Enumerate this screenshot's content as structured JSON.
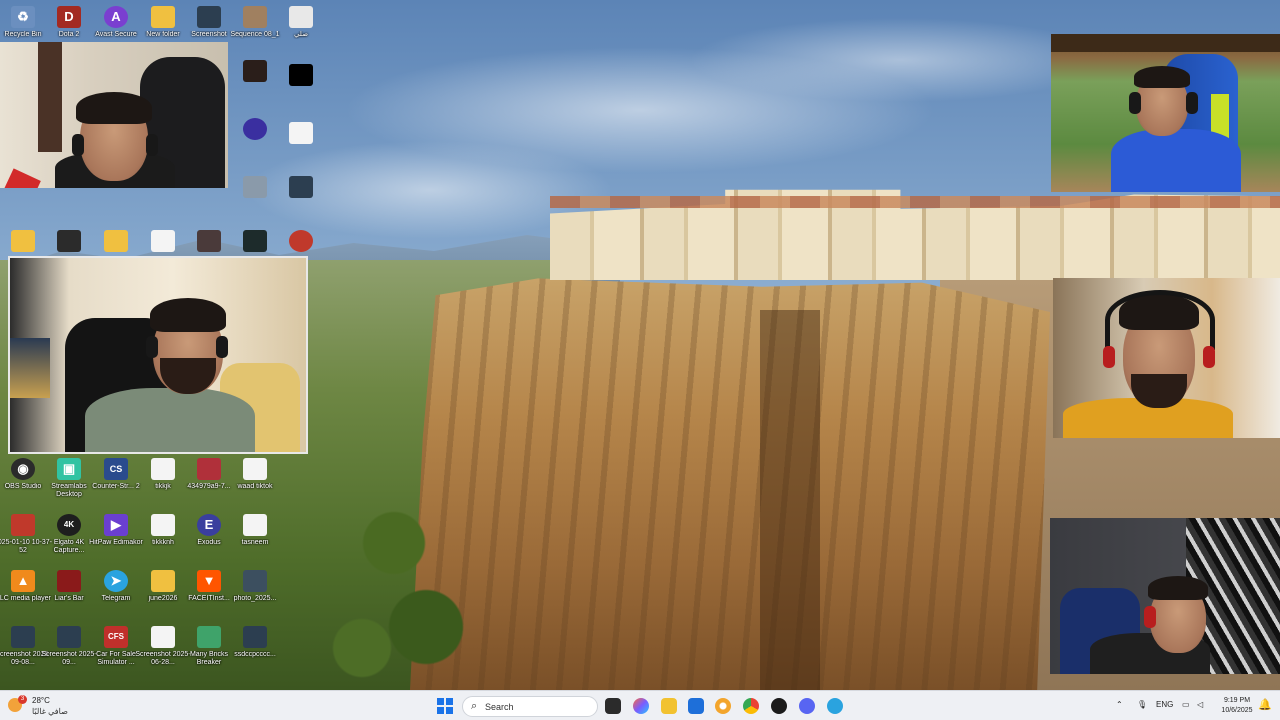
{
  "desktop_icons": [
    {
      "label": "Recycle Bin",
      "icon": "recycle-bin-icon",
      "glyph": "♻",
      "color": "#6b8fbf"
    },
    {
      "label": "Dota 2",
      "icon": "dota2-icon",
      "glyph": "D",
      "color": "#a32a22"
    },
    {
      "label": "Avast Secure",
      "icon": "avast-browser-icon",
      "glyph": "A",
      "color": "#7a3fd0"
    },
    {
      "label": "New folder",
      "icon": "folder-icon",
      "glyph": "",
      "color": "#f0c040"
    },
    {
      "label": "Screenshot",
      "icon": "image-file-icon",
      "glyph": "",
      "color": "#2c3e50"
    },
    {
      "label": "Sequence 08_1",
      "icon": "video-file-icon",
      "glyph": "",
      "color": "#a08060"
    },
    {
      "label": "صلي",
      "icon": "document-icon",
      "glyph": "",
      "color": "#e8e8e8"
    },
    {
      "label": "OBS Studio",
      "icon": "obs-studio-icon",
      "glyph": "◉",
      "color": "#2b2b2b"
    },
    {
      "label": "Streamlabs Desktop",
      "icon": "streamlabs-icon",
      "glyph": "▣",
      "color": "#31c3a2"
    },
    {
      "label": "Counter-Str... 2",
      "icon": "counter-strike-icon",
      "glyph": "CS",
      "color": "#2a4b8d"
    },
    {
      "label": "tikkjk",
      "icon": "text-file-icon",
      "glyph": "",
      "color": "#f4f4f4"
    },
    {
      "label": "434979a9-7...",
      "icon": "video-file-icon",
      "glyph": "",
      "color": "#b0303a"
    },
    {
      "label": "waad tiktok",
      "icon": "text-file-icon",
      "glyph": "",
      "color": "#f4f4f4"
    },
    {
      "label": "2025-01-10 10-37-52",
      "icon": "video-file-icon",
      "glyph": "",
      "color": "#c0392b"
    },
    {
      "label": "Elgato 4K Capture...",
      "icon": "elgato-icon",
      "glyph": "4K",
      "color": "#1e1e1e"
    },
    {
      "label": "HitPaw Edimakor",
      "icon": "hitpaw-icon",
      "glyph": "▶",
      "color": "#6a3fd0"
    },
    {
      "label": "tikkknh",
      "icon": "text-file-icon",
      "glyph": "",
      "color": "#f4f4f4"
    },
    {
      "label": "Exodus",
      "icon": "exodus-icon",
      "glyph": "E",
      "color": "#3a3f9e"
    },
    {
      "label": "tasneem",
      "icon": "text-file-icon",
      "glyph": "",
      "color": "#f4f4f4"
    },
    {
      "label": "VLC media player",
      "icon": "vlc-icon",
      "glyph": "▲",
      "color": "#f08a1c"
    },
    {
      "label": "Liar's Bar",
      "icon": "liars-bar-icon",
      "glyph": "",
      "color": "#8a1a1a"
    },
    {
      "label": "Telegram",
      "icon": "telegram-icon",
      "glyph": "➤",
      "color": "#2aa3df"
    },
    {
      "label": "june2026",
      "icon": "folder-icon",
      "glyph": "",
      "color": "#f0c040"
    },
    {
      "label": "FACEITInst...",
      "icon": "faceit-icon",
      "glyph": "▼",
      "color": "#ff5500"
    },
    {
      "label": "photo_2025...",
      "icon": "image-file-icon",
      "glyph": "",
      "color": "#3c4f5f"
    },
    {
      "label": "Screenshot 2025-09-08...",
      "icon": "image-file-icon",
      "glyph": "",
      "color": "#2c3e50"
    },
    {
      "label": "Screenshot 2025-09...",
      "icon": "image-file-icon",
      "glyph": "",
      "color": "#2c3e50"
    },
    {
      "label": "Car For Sale Simulator ...",
      "icon": "car-for-sale-icon",
      "glyph": "CFS",
      "color": "#c0302b"
    },
    {
      "label": "Screenshot 2025-06-28...",
      "icon": "text-file-icon",
      "glyph": "",
      "color": "#f4f4f4"
    },
    {
      "label": "Many Bricks Breaker",
      "icon": "bricks-breaker-icon",
      "glyph": "",
      "color": "#3fa36a"
    },
    {
      "label": "ssdccpcccc...",
      "icon": "image-file-icon",
      "glyph": "",
      "color": "#2c3e50"
    }
  ],
  "taskbar": {
    "weather": {
      "temp": "28°C",
      "condition": "صافي غالبًا",
      "badge": "3"
    },
    "search_placeholder": "Search",
    "tray": {
      "language": "ENG"
    },
    "clock": {
      "time": "9:19 PM",
      "date": "10/6/2025"
    }
  },
  "colors": {
    "taskbar_bg": "#eef0f4",
    "start_blue": "#1a73e8"
  }
}
